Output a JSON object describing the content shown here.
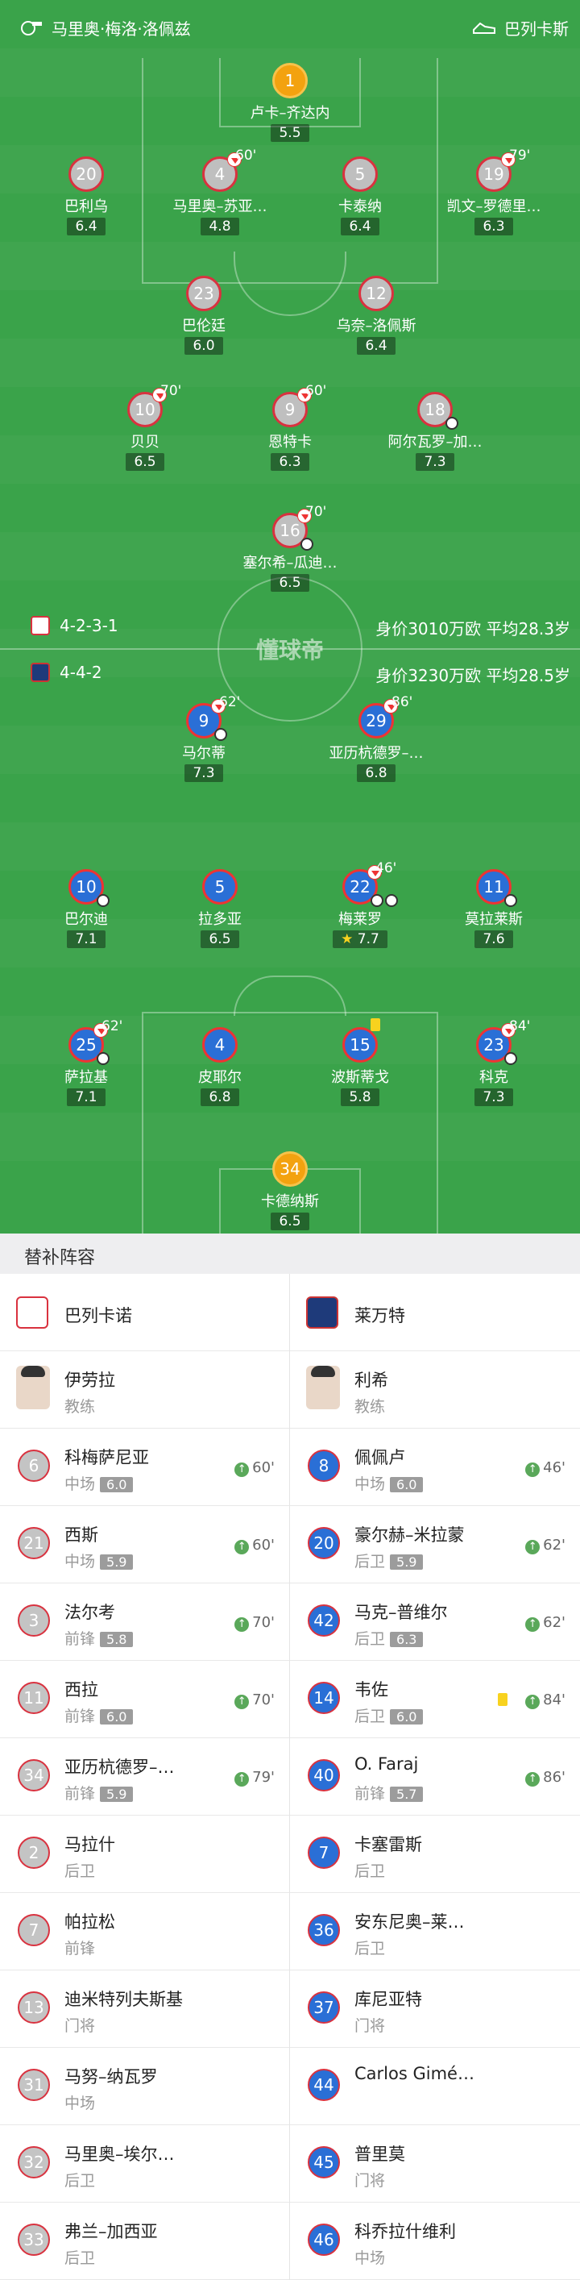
{
  "header": {
    "home_team": "马里奥·梅洛·洛佩兹",
    "away_team": "巴列卡斯"
  },
  "watermark": "懂球帝",
  "home": {
    "formation": "4-2-3-1",
    "value_text": "身价3010万欧 平均28.3岁"
  },
  "away": {
    "formation": "4-4-2",
    "value_text": "身价3230万欧 平均28.5岁"
  },
  "players": [
    {
      "n": "1",
      "name": "卢卡–齐达内",
      "r": "5.5"
    },
    {
      "n": "20",
      "name": "巴利乌",
      "r": "6.4"
    },
    {
      "n": "4",
      "name": "马里奥–苏亚…",
      "r": "4.8",
      "sub": "60'"
    },
    {
      "n": "5",
      "name": "卡泰纳",
      "r": "6.4"
    },
    {
      "n": "19",
      "name": "凯文–罗德里…",
      "r": "6.3",
      "sub": "79'"
    },
    {
      "n": "23",
      "name": "巴伦廷",
      "r": "6.0"
    },
    {
      "n": "12",
      "name": "乌奈–洛佩斯",
      "r": "6.4"
    },
    {
      "n": "10",
      "name": "贝贝",
      "r": "6.5",
      "sub": "70'"
    },
    {
      "n": "9",
      "name": "恩特卡",
      "r": "6.3",
      "sub": "60'"
    },
    {
      "n": "18",
      "name": "阿尔瓦罗–加…",
      "r": "7.3"
    },
    {
      "n": "16",
      "name": "塞尔希–瓜迪…",
      "r": "6.5",
      "sub": "70'"
    },
    {
      "n": "9",
      "name": "马尔蒂",
      "r": "7.3",
      "sub": "62'"
    },
    {
      "n": "29",
      "name": "亚历杭德罗–…",
      "r": "6.8",
      "sub": "86'"
    },
    {
      "n": "10",
      "name": "巴尔迪",
      "r": "7.1"
    },
    {
      "n": "5",
      "name": "拉多亚",
      "r": "6.5"
    },
    {
      "n": "22",
      "name": "梅莱罗",
      "r": "7.7",
      "sub": "46'"
    },
    {
      "n": "11",
      "name": "莫拉莱斯",
      "r": "7.6"
    },
    {
      "n": "25",
      "name": "萨拉基",
      "r": "7.1",
      "sub": "62'"
    },
    {
      "n": "4",
      "name": "皮耶尔",
      "r": "6.8"
    },
    {
      "n": "15",
      "name": "波斯蒂戈",
      "r": "5.8"
    },
    {
      "n": "23",
      "name": "科克",
      "r": "7.3",
      "sub": "84'"
    },
    {
      "n": "34",
      "name": "卡德纳斯",
      "r": "6.5"
    }
  ],
  "bench": {
    "title": "替补阵容",
    "home_team": "巴列卡诺",
    "away_team": "莱万特",
    "home_coach": {
      "name": "伊劳拉",
      "role": "教练"
    },
    "away_coach": {
      "name": "利希",
      "role": "教练"
    },
    "home": [
      {
        "n": "6",
        "name": "科梅萨尼亚",
        "pos": "中场",
        "r": "6.0",
        "in": "60'"
      },
      {
        "n": "21",
        "name": "西斯",
        "pos": "中场",
        "r": "5.9",
        "in": "60'"
      },
      {
        "n": "3",
        "name": "法尔考",
        "pos": "前锋",
        "r": "5.8",
        "in": "70'"
      },
      {
        "n": "11",
        "name": "西拉",
        "pos": "前锋",
        "r": "6.0",
        "in": "70'"
      },
      {
        "n": "34",
        "name": "亚历杭德罗–…",
        "pos": "前锋",
        "r": "5.9",
        "in": "79'"
      },
      {
        "n": "2",
        "name": "马拉什",
        "pos": "后卫"
      },
      {
        "n": "7",
        "name": "帕拉松",
        "pos": "前锋"
      },
      {
        "n": "13",
        "name": "迪米特列夫斯基",
        "pos": "门将"
      },
      {
        "n": "31",
        "name": "马努–纳瓦罗",
        "pos": "中场"
      },
      {
        "n": "32",
        "name": "马里奥–埃尔…",
        "pos": "后卫"
      },
      {
        "n": "33",
        "name": "弗兰–加西亚",
        "pos": "后卫"
      }
    ],
    "away": [
      {
        "n": "8",
        "name": "佩佩卢",
        "pos": "中场",
        "r": "6.0",
        "in": "46'"
      },
      {
        "n": "20",
        "name": "豪尔赫–米拉蒙",
        "pos": "后卫",
        "r": "5.9",
        "in": "62'"
      },
      {
        "n": "42",
        "name": "马克–普维尔",
        "pos": "后卫",
        "r": "6.3",
        "in": "62'"
      },
      {
        "n": "14",
        "name": "韦佐",
        "pos": "后卫",
        "r": "6.0",
        "in": "84'"
      },
      {
        "n": "40",
        "name": "O. Faraj",
        "pos": "前锋",
        "r": "5.7",
        "in": "86'"
      },
      {
        "n": "7",
        "name": "卡塞雷斯",
        "pos": "后卫"
      },
      {
        "n": "36",
        "name": "安东尼奥–莱…",
        "pos": "后卫"
      },
      {
        "n": "37",
        "name": "库尼亚特",
        "pos": "门将"
      },
      {
        "n": "44",
        "name": "Carlos Gimé…",
        "pos": ""
      },
      {
        "n": "45",
        "name": "普里莫",
        "pos": "门将"
      },
      {
        "n": "46",
        "name": "科乔拉什维利",
        "pos": "中场"
      }
    ]
  }
}
